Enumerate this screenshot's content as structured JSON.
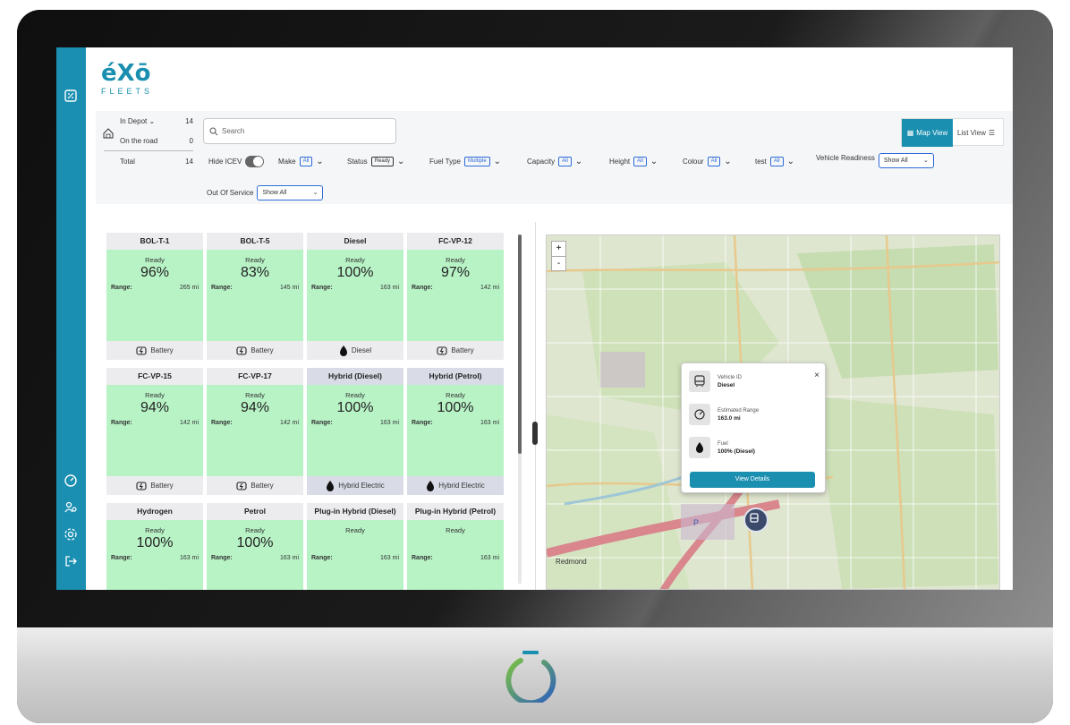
{
  "colors": {
    "accent": "#1a8fb0",
    "ready_green": "#b8f3c6",
    "pill_blue": "#2d6bd9"
  },
  "brand": {
    "mark": "éXō",
    "subtitle": "FLEETS"
  },
  "depot": [
    {
      "label": "In Depot",
      "count": "14"
    },
    {
      "label": "On the road",
      "count": "0"
    },
    {
      "label": "Total",
      "count": "14"
    }
  ],
  "search": {
    "placeholder": "Search"
  },
  "views": {
    "map": "Map View",
    "list": "List View"
  },
  "filters": {
    "hide_icev": "Hide ICEV",
    "make": {
      "label": "Make",
      "value": "All"
    },
    "status": {
      "label": "Status",
      "value": "Ready"
    },
    "fuel": {
      "label": "Fuel Type",
      "value": "Multiple"
    },
    "capacity": {
      "label": "Capacity",
      "value": "All"
    },
    "height": {
      "label": "Height",
      "value": "All"
    },
    "colour": {
      "label": "Colour",
      "value": "All"
    },
    "test": {
      "label": "test",
      "value": "All"
    },
    "readiness": {
      "label": "Vehicle Readiness",
      "value": "Show All"
    },
    "oos": {
      "label": "Out Of Service",
      "value": "Show All"
    }
  },
  "range_label": "Range:",
  "cards": [
    {
      "name": "BOL-T-1",
      "status": "Ready",
      "pct": "96%",
      "range": "265 mi",
      "fuel": "Battery"
    },
    {
      "name": "BOL-T-5",
      "status": "Ready",
      "pct": "83%",
      "range": "145 mi",
      "fuel": "Battery"
    },
    {
      "name": "Diesel",
      "status": "Ready",
      "pct": "100%",
      "range": "163 mi",
      "fuel": "Diesel"
    },
    {
      "name": "FC-VP-12",
      "status": "Ready",
      "pct": "97%",
      "range": "142 mi",
      "fuel": "Battery"
    },
    {
      "name": "FC-VP-15",
      "status": "Ready",
      "pct": "94%",
      "range": "142 mi",
      "fuel": "Battery"
    },
    {
      "name": "FC-VP-17",
      "status": "Ready",
      "pct": "94%",
      "range": "142 mi",
      "fuel": "Battery"
    },
    {
      "name": "Hybrid (Diesel)",
      "status": "Ready",
      "pct": "100%",
      "range": "163 mi",
      "fuel": "Hybrid Electric"
    },
    {
      "name": "Hybrid (Petrol)",
      "status": "Ready",
      "pct": "100%",
      "range": "163 mi",
      "fuel": "Hybrid Electric"
    },
    {
      "name": "Hydrogen",
      "status": "Ready",
      "pct": "100%",
      "range": "163 mi",
      "fuel": ""
    },
    {
      "name": "Petrol",
      "status": "Ready",
      "pct": "100%",
      "range": "163 mi",
      "fuel": ""
    },
    {
      "name": "Plug-in Hybrid (Diesel)",
      "status": "Ready",
      "pct": "",
      "range": "163 mi",
      "fuel": ""
    },
    {
      "name": "Plug-in Hybrid (Petrol)",
      "status": "Ready",
      "pct": "",
      "range": "163 mi",
      "fuel": ""
    }
  ],
  "map": {
    "zoom_in": "+",
    "zoom_out": "-",
    "places": {
      "redmond": "Redmond",
      "p": "P"
    }
  },
  "popup": {
    "vehicle_id_label": "Vehicle ID",
    "vehicle_id": "Diesel",
    "range_label": "Estimated Range",
    "range": "163.0 mi",
    "fuel_label": "Fuel",
    "fuel": "100% (Diesel)",
    "close": "×",
    "button": "View Details"
  }
}
